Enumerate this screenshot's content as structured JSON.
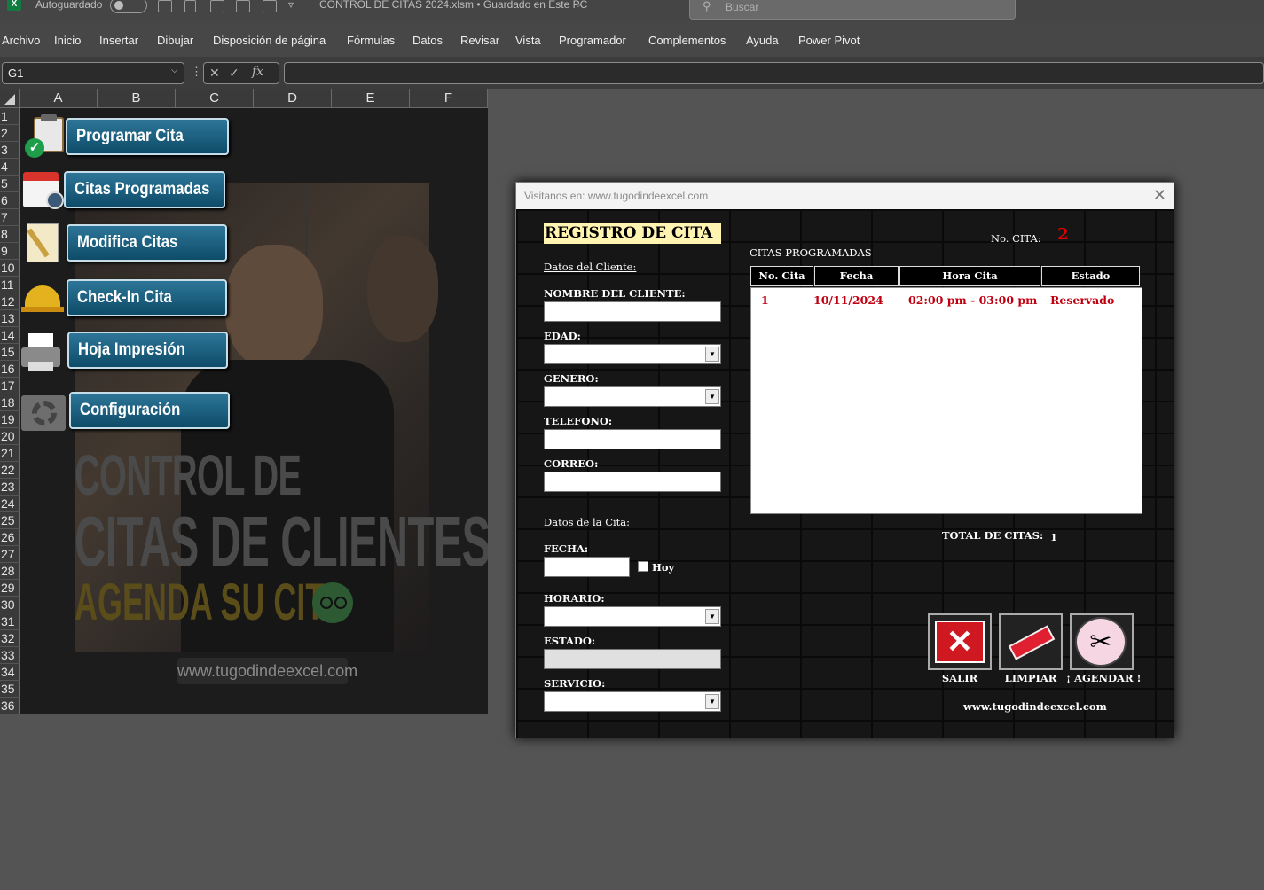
{
  "titlebar": {
    "autosave_label": "Autoguardado",
    "file_title": "CONTROL DE CITAS 2024.xlsm  •  Guardado en Este PC",
    "search_placeholder": "Buscar"
  },
  "menu": [
    "Archivo",
    "Inicio",
    "Insertar",
    "Dibujar",
    "Disposición de página",
    "Fórmulas",
    "Datos",
    "Revisar",
    "Vista",
    "Programador",
    "Complementos",
    "Ayuda",
    "Power Pivot"
  ],
  "formula_bar": {
    "name_box": "G1",
    "fx": "fx"
  },
  "columns": [
    "A",
    "B",
    "C",
    "D",
    "E",
    "F"
  ],
  "rows": [
    "1",
    "2",
    "3",
    "4",
    "5",
    "6",
    "7",
    "8",
    "9",
    "10",
    "11",
    "12",
    "13",
    "14",
    "15",
    "16",
    "17",
    "18",
    "19",
    "20",
    "21",
    "22",
    "23",
    "24",
    "25",
    "26",
    "27",
    "28",
    "29",
    "30",
    "31",
    "32",
    "33",
    "34",
    "35",
    "36"
  ],
  "sheet": {
    "buttons": {
      "programar": "Programar Cita",
      "citas": "Citas Programadas",
      "modifica": "Modifica Citas",
      "checkin": "Check-In Cita",
      "hoja": "Hoja Impresión",
      "config": "Configuración"
    },
    "poster": {
      "line1": "CONTROL DE",
      "line2": "CITAS DE CLIENTES",
      "line3": "AGENDA SU CITA",
      "website": "www.tugodindeexcel.com"
    }
  },
  "dialog": {
    "title": "Visitanos en: www.tugodindeexcel.com",
    "close": "✕",
    "heading": "REGISTRO DE CITA",
    "no_cita_label": "No. CITA:",
    "no_cita_value": "2",
    "section_cliente": "Datos del Cliente:",
    "nombre_label": "NOMBRE DEL CLIENTE:",
    "edad_label": "EDAD:",
    "genero_label": "GENERO:",
    "telefono_label": "TELEFONO:",
    "correo_label": "CORREO:",
    "section_cita": "Datos de la Cita:",
    "fecha_label": "FECHA:",
    "hoy_label": "Hoy",
    "horario_label": "HORARIO:",
    "estado_label": "ESTADO:",
    "servicio_label": "SERVICIO:",
    "list_title": "CITAS PROGRAMADAS",
    "list_headers": [
      "No. Cita",
      "Fecha",
      "Hora Cita",
      "Estado"
    ],
    "list_rows": [
      {
        "no": "1",
        "fecha": "10/11/2024",
        "hora": "02:00 pm - 03:00 pm",
        "estado": "Reservado"
      }
    ],
    "total_label": "TOTAL DE CITAS:",
    "total_value": "1",
    "salir": "SALIR",
    "limpiar": "LIMPIAR",
    "agendar": "¡ AGENDAR !",
    "website": "www.tugodindeexcel.com"
  }
}
